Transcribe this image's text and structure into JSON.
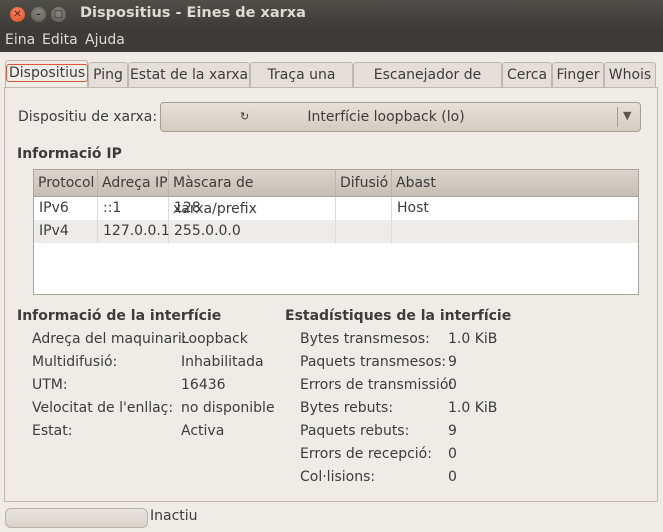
{
  "window": {
    "title": "Dispositius - Eines de xarxa"
  },
  "menu": [
    "Eina",
    "Edita",
    "Ajuda"
  ],
  "tabs": [
    "Dispositius",
    "Ping",
    "Estat de la xarxa",
    "Traça una ruta",
    "Escanejador de ports",
    "Cerca",
    "Finger",
    "Whois"
  ],
  "device": {
    "label": "Dispositiu de xarxa:",
    "value": "Interfície loopback (lo)"
  },
  "ip_info": {
    "title": "Informació IP",
    "columns": [
      "Protocol",
      "Adreça IP",
      "Màscara de xarxa/prefix",
      "Difusió",
      "Abast"
    ],
    "rows": [
      [
        "IPv6",
        "::1",
        "128",
        "",
        "Host"
      ],
      [
        "IPv4",
        "127.0.0.1",
        "255.0.0.0",
        "",
        ""
      ]
    ]
  },
  "interface_info": {
    "title": "Informació de la interfície",
    "items": [
      {
        "label": "Adreça del maquinari:",
        "value": "Loopback"
      },
      {
        "label": "Multidifusió:",
        "value": "Inhabilitada"
      },
      {
        "label": "UTM:",
        "value": "16436"
      },
      {
        "label": "Velocitat de l'enllaç:",
        "value": "no disponible"
      },
      {
        "label": "Estat:",
        "value": "Activa"
      }
    ]
  },
  "interface_stats": {
    "title": "Estadístiques de la interfície",
    "items": [
      {
        "label": "Bytes transmesos:",
        "value": "1.0 KiB"
      },
      {
        "label": "Paquets transmesos:",
        "value": "9"
      },
      {
        "label": "Errors de transmissió:",
        "value": "0"
      },
      {
        "label": "Bytes rebuts:",
        "value": "1.0 KiB"
      },
      {
        "label": "Paquets rebuts:",
        "value": "9"
      },
      {
        "label": "Errors de recepció:",
        "value": "0"
      },
      {
        "label": "Col·lisions:",
        "value": "0"
      }
    ]
  },
  "status": {
    "text": "Inactiu",
    "progress": 0
  }
}
